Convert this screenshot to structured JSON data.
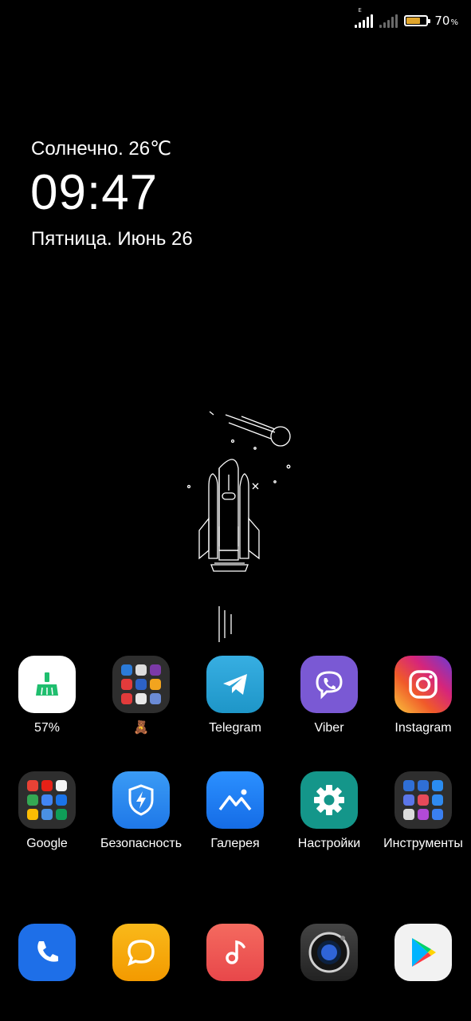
{
  "status_bar": {
    "network_type": "E",
    "battery_level": 0.7,
    "battery_percent": "70",
    "battery_unit": "%"
  },
  "widget": {
    "weather": "Солнечно. 26℃",
    "time": "09:47",
    "date": "Пятница. Июнь 26"
  },
  "row1": [
    {
      "label": "57%",
      "icon": "cleaner-broom-icon"
    },
    {
      "label": "🧸",
      "icon": "games-folder-icon"
    },
    {
      "label": "Telegram",
      "icon": "telegram-icon"
    },
    {
      "label": "Viber",
      "icon": "viber-icon"
    },
    {
      "label": "Instagram",
      "icon": "instagram-icon"
    }
  ],
  "row2": [
    {
      "label": "Google",
      "icon": "google-folder-icon"
    },
    {
      "label": "Безопасность",
      "icon": "security-shield-icon"
    },
    {
      "label": "Галерея",
      "icon": "gallery-icon"
    },
    {
      "label": "Настройки",
      "icon": "settings-gear-icon"
    },
    {
      "label": "Инструменты",
      "icon": "tools-folder-icon"
    }
  ],
  "dock": [
    {
      "icon": "phone-icon"
    },
    {
      "icon": "messages-icon"
    },
    {
      "icon": "music-icon"
    },
    {
      "icon": "camera-icon"
    },
    {
      "icon": "play-store-icon"
    }
  ],
  "colors": {
    "background": "#000000",
    "battery_fill": "#e0a52c",
    "telegram": "#2aa3e0",
    "viber": "#7a59d4",
    "security": "#2a8af0",
    "gallery": "#1b7ff5",
    "settings": "#14968a",
    "phone": "#1e6fe8",
    "messages": "#f5a500",
    "music": "#f05a57"
  }
}
